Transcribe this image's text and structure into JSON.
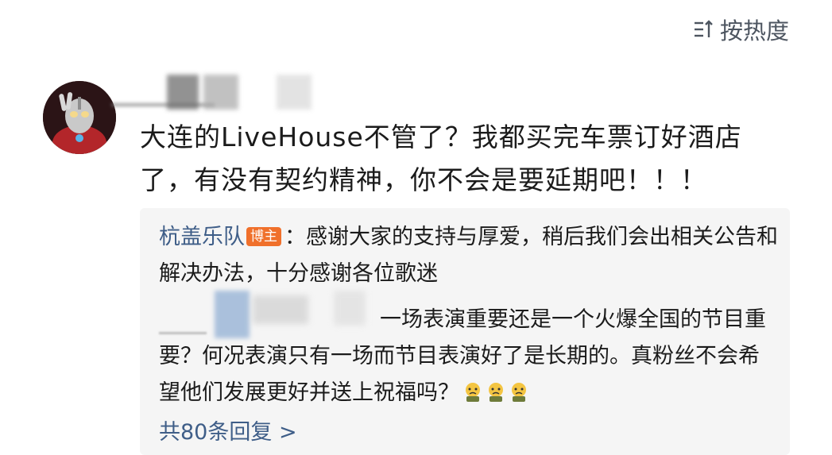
{
  "sort_label": "按热度",
  "comment": {
    "text": "大连的LiveHouse不管了？我都买完车票订好酒店了，有没有契约精神，你不会是要延期吧！！！"
  },
  "replies": [
    {
      "author": "杭盖乐队",
      "badge": "博主",
      "text": "：感谢大家的支持与厚爱，稍后我们会出相关公告和解决办法，十分感谢各位歌迷"
    },
    {
      "text": "一场表演重要还是一个火爆全国的节目重要？何况表演只有一场而节目表演好了是长期的。真粉丝不会希望他们发展更好并送上祝福吗？"
    }
  ],
  "more_replies": "共80条回复 >"
}
